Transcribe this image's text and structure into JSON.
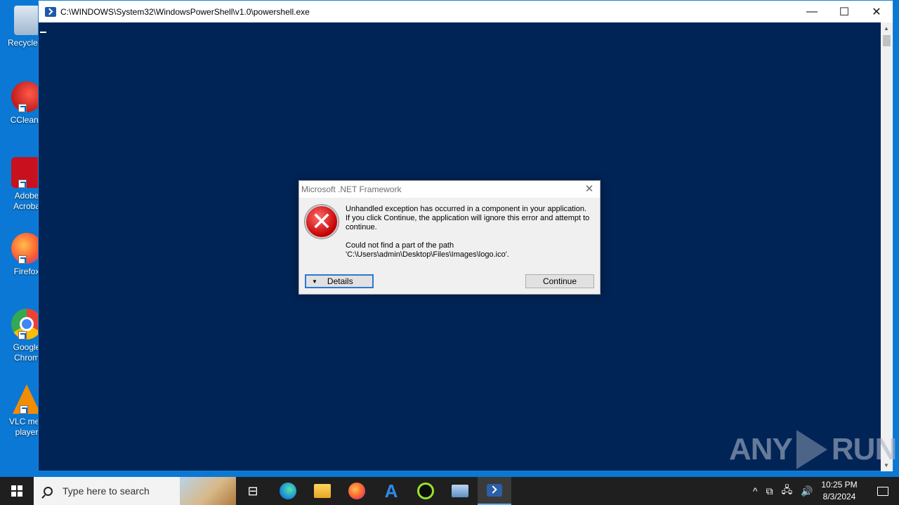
{
  "desktop": {
    "icons": [
      {
        "label": "Recycle B",
        "icon": "recycle-bin-icon"
      },
      {
        "label": "CCleane",
        "icon": "ccleaner-icon"
      },
      {
        "label": "Adobe\nAcroba",
        "icon": "adobe-acrobat-icon"
      },
      {
        "label": "Firefox",
        "icon": "firefox-icon"
      },
      {
        "label": "Google\nChrom",
        "icon": "chrome-icon"
      },
      {
        "label": "VLC med\nplayer",
        "icon": "vlc-icon"
      }
    ]
  },
  "powershell": {
    "title": "C:\\WINDOWS\\System32\\WindowsPowerShell\\v1.0\\powershell.exe",
    "minimize": "—",
    "maximize": "☐",
    "close": "✕",
    "background": "#012456"
  },
  "dialog": {
    "title": "Microsoft .NET Framework",
    "close": "✕",
    "message_main": "Unhandled exception has occurred in a component in your application.\nIf you click Continue, the application will ignore this error and attempt to\ncontinue.",
    "message_detail": "Could not find a part of the path\n'C:\\Users\\admin\\Desktop\\Files\\Images\\logo.ico'.",
    "details_label": "Details",
    "continue_label": "Continue",
    "error_glyph": "✕"
  },
  "watermark": {
    "left": "ANY",
    "right": "RUN"
  },
  "taskbar": {
    "search_placeholder": "Type here to search",
    "task_view_glyph": "⊟",
    "azure_glyph": "A",
    "tray_icons": [
      "chevron-up-icon",
      "meet-now-icon",
      "network-icon",
      "volume-icon"
    ],
    "tray_glyphs": {
      "chevron": "^",
      "meet": "⧉",
      "network": "🖧",
      "volume": "🔊"
    },
    "time": "10:25 PM",
    "date": "8/3/2024"
  }
}
